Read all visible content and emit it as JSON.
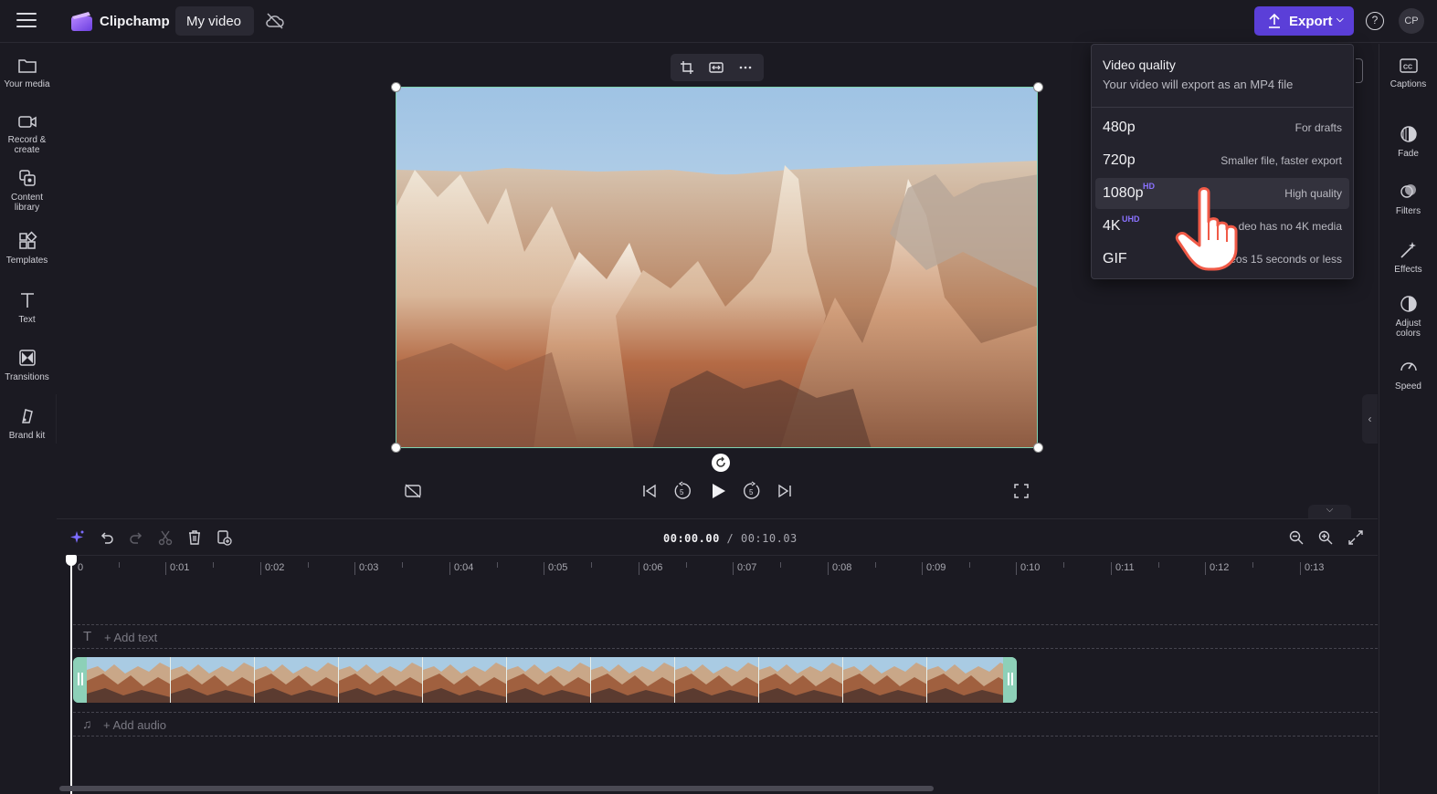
{
  "topbar": {
    "app_name": "Clipchamp",
    "video_title": "My video",
    "export_label": "Export",
    "help": "?",
    "avatar": "CP",
    "accent": "#5b3fd8"
  },
  "left_sidebar": {
    "items": [
      {
        "label_1": "Your media",
        "label_2": "",
        "icon": "folder-icon"
      },
      {
        "label_1": "Record &",
        "label_2": "create",
        "icon": "camera-icon"
      },
      {
        "label_1": "Content",
        "label_2": "library",
        "icon": "library-icon"
      },
      {
        "label_1": "Templates",
        "label_2": "",
        "icon": "templates-icon"
      },
      {
        "label_1": "Text",
        "label_2": "",
        "icon": "text-icon"
      },
      {
        "label_1": "Transitions",
        "label_2": "",
        "icon": "transitions-icon"
      },
      {
        "label_1": "Brand kit",
        "label_2": "",
        "icon": "brand-kit-icon"
      }
    ]
  },
  "right_sidebar": {
    "items": [
      {
        "label_1": "Captions",
        "label_2": "",
        "icon": "captions-icon"
      },
      {
        "label_1": "Fade",
        "label_2": "",
        "icon": "fade-icon"
      },
      {
        "label_1": "Filters",
        "label_2": "",
        "icon": "filters-icon"
      },
      {
        "label_1": "Effects",
        "label_2": "",
        "icon": "effects-icon"
      },
      {
        "label_1": "Adjust",
        "label_2": "colors",
        "icon": "adjust-colors-icon"
      },
      {
        "label_1": "Speed",
        "label_2": "",
        "icon": "speed-icon"
      }
    ]
  },
  "export_menu": {
    "title": "Video quality",
    "subtitle": "Your video will export as an MP4 file",
    "options": [
      {
        "name": "480p",
        "tag": "",
        "desc": "For drafts",
        "selected": false
      },
      {
        "name": "720p",
        "tag": "",
        "desc": "Smaller file, faster export",
        "selected": false
      },
      {
        "name": "1080p",
        "tag": "HD",
        "desc": "High quality",
        "selected": true
      },
      {
        "name": "4K",
        "tag": "UHD",
        "desc": "deo has no 4K media",
        "selected": false
      },
      {
        "name": "GIF",
        "tag": "",
        "desc": "eos 15 seconds or less",
        "selected": false
      }
    ]
  },
  "timeline": {
    "current_time": "00:00.00",
    "total_time": "/ 00:10.03",
    "ruler_labels": [
      "0",
      "0:01",
      "0:02",
      "0:03",
      "0:04",
      "0:05",
      "0:06",
      "0:07",
      "0:08",
      "0:09",
      "0:10",
      "0:11",
      "0:12",
      "0:13"
    ],
    "add_text": "+ Add text",
    "add_audio": "+ Add audio",
    "clip_color": "#7fc8b0"
  }
}
